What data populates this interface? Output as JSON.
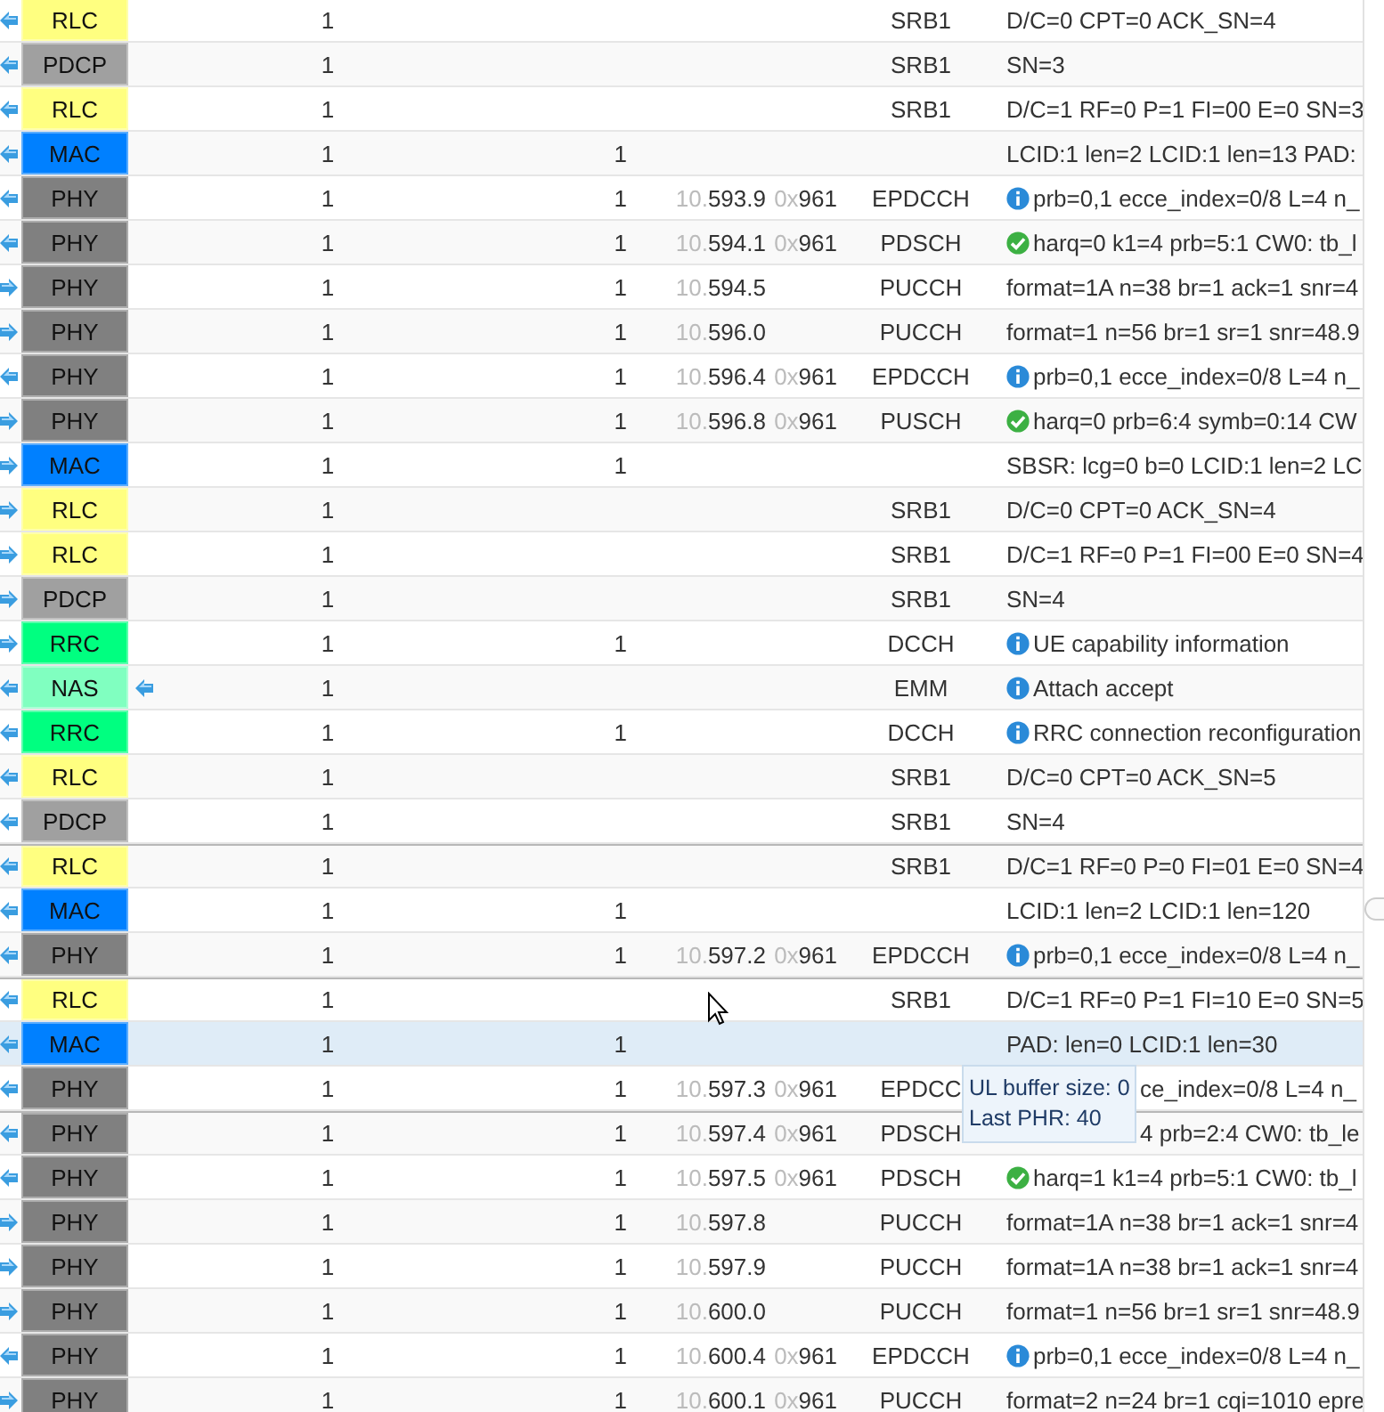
{
  "rows": [
    {
      "uplink": false,
      "layer": "RLC",
      "color": "#ffff80",
      "col2": "1",
      "channel": "SRB1",
      "kind": "plain",
      "message": "D/C=0 CPT=0 ACK_SN=4",
      "selected": false
    },
    {
      "uplink": false,
      "layer": "PDCP",
      "color": "#a0a0a0",
      "col2": "1",
      "channel": "SRB1",
      "kind": "plain",
      "message": "SN=3",
      "selected": false
    },
    {
      "uplink": false,
      "layer": "RLC",
      "color": "#ffff80",
      "col2": "1",
      "channel": "SRB1",
      "kind": "plain",
      "message": "D/C=1 RF=0 P=1 FI=00 E=0 SN=3",
      "selected": false
    },
    {
      "uplink": false,
      "layer": "MAC",
      "color": "#0080ff",
      "col2": "1",
      "col3": "1",
      "kind": "plain",
      "message": "LCID:1 len=2 LCID:1 len=13 PAD:",
      "selected": false
    },
    {
      "uplink": false,
      "layer": "PHY",
      "color": "#808080",
      "col2": "1",
      "col3": "1",
      "time_dim": "10.",
      "time": "593.9",
      "rnti_dim": "0x",
      "rnti": "961",
      "channel": "EPDCCH",
      "kind": "info",
      "message": "prb=0,1 ecce_index=0/8 L=4 n_",
      "selected": false
    },
    {
      "uplink": false,
      "layer": "PHY",
      "color": "#808080",
      "col2": "1",
      "col3": "1",
      "time_dim": "10.",
      "time": "594.1",
      "rnti_dim": "0x",
      "rnti": "961",
      "channel": "PDSCH",
      "kind": "ok",
      "message": "harq=0 k1=4 prb=5:1 CW0: tb_l",
      "selected": false
    },
    {
      "uplink": true,
      "layer": "PHY",
      "color": "#808080",
      "col2": "1",
      "col3": "1",
      "time_dim": "10.",
      "time": "594.5",
      "channel": "PUCCH",
      "kind": "plain",
      "message": "format=1A n=38 br=1 ack=1 snr=4",
      "selected": false
    },
    {
      "uplink": true,
      "layer": "PHY",
      "color": "#808080",
      "col2": "1",
      "col3": "1",
      "time_dim": "10.",
      "time": "596.0",
      "channel": "PUCCH",
      "kind": "plain",
      "message": "format=1 n=56 br=1 sr=1 snr=48.9",
      "selected": false
    },
    {
      "uplink": false,
      "layer": "PHY",
      "color": "#808080",
      "col2": "1",
      "col3": "1",
      "time_dim": "10.",
      "time": "596.4",
      "rnti_dim": "0x",
      "rnti": "961",
      "channel": "EPDCCH",
      "kind": "info",
      "message": "prb=0,1 ecce_index=0/8 L=4 n_",
      "selected": false
    },
    {
      "uplink": true,
      "layer": "PHY",
      "color": "#808080",
      "col2": "1",
      "col3": "1",
      "time_dim": "10.",
      "time": "596.8",
      "rnti_dim": "0x",
      "rnti": "961",
      "channel": "PUSCH",
      "kind": "ok",
      "message": "harq=0 prb=6:4 symb=0:14 CW",
      "selected": false
    },
    {
      "uplink": true,
      "layer": "MAC",
      "color": "#0080ff",
      "col2": "1",
      "col3": "1",
      "kind": "plain",
      "message": "SBSR: lcg=0 b=0 LCID:1 len=2 LC",
      "selected": false
    },
    {
      "uplink": true,
      "layer": "RLC",
      "color": "#ffff80",
      "col2": "1",
      "channel": "SRB1",
      "kind": "plain",
      "message": "D/C=0 CPT=0 ACK_SN=4",
      "selected": false
    },
    {
      "uplink": true,
      "layer": "RLC",
      "color": "#ffff80",
      "col2": "1",
      "channel": "SRB1",
      "kind": "plain",
      "message": "D/C=1 RF=0 P=1 FI=00 E=0 SN=4",
      "selected": false
    },
    {
      "uplink": true,
      "layer": "PDCP",
      "color": "#a0a0a0",
      "col2": "1",
      "channel": "SRB1",
      "kind": "plain",
      "message": "SN=4",
      "selected": false
    },
    {
      "uplink": true,
      "layer": "RRC",
      "color": "#00ff80",
      "col2": "1",
      "col3": "1",
      "channel": "DCCH",
      "kind": "info",
      "message": "UE capability information",
      "selected": false
    },
    {
      "uplink": false,
      "layer": "NAS",
      "color": "#80ffc0",
      "extra_arrow": true,
      "col2": "1",
      "channel": "EMM",
      "kind": "info",
      "message": "Attach accept",
      "selected": false
    },
    {
      "uplink": false,
      "layer": "RRC",
      "color": "#00ff80",
      "col2": "1",
      "col3": "1",
      "channel": "DCCH",
      "kind": "info",
      "message": "RRC connection reconfiguration",
      "selected": false
    },
    {
      "uplink": false,
      "layer": "RLC",
      "color": "#ffff80",
      "col2": "1",
      "channel": "SRB1",
      "kind": "plain",
      "message": "D/C=0 CPT=0 ACK_SN=5",
      "selected": false
    },
    {
      "uplink": false,
      "layer": "PDCP",
      "color": "#a0a0a0",
      "col2": "1",
      "channel": "SRB1",
      "kind": "plain",
      "message": "SN=4",
      "selected": false
    },
    {
      "uplink": false,
      "layer": "RLC",
      "color": "#ffff80",
      "separator": true,
      "col2": "1",
      "channel": "SRB1",
      "kind": "plain",
      "message": "D/C=1 RF=0 P=0 FI=01 E=0 SN=4",
      "selected": false
    },
    {
      "uplink": false,
      "layer": "MAC",
      "color": "#0080ff",
      "col2": "1",
      "col3": "1",
      "kind": "plain",
      "message": "LCID:1 len=2 LCID:1 len=120",
      "selected": false
    },
    {
      "uplink": false,
      "layer": "PHY",
      "color": "#808080",
      "col2": "1",
      "col3": "1",
      "time_dim": "10.",
      "time": "597.2",
      "rnti_dim": "0x",
      "rnti": "961",
      "channel": "EPDCCH",
      "kind": "info",
      "message": "prb=0,1 ecce_index=0/8 L=4 n_",
      "selected": false
    },
    {
      "uplink": false,
      "layer": "RLC",
      "color": "#ffff80",
      "separator": true,
      "col2": "1",
      "channel": "SRB1",
      "kind": "plain",
      "message": "D/C=1 RF=0 P=1 FI=10 E=0 SN=5",
      "selected": false
    },
    {
      "uplink": false,
      "layer": "MAC",
      "color": "#0080ff",
      "col2": "1",
      "col3": "1",
      "kind": "plain",
      "message": "PAD: len=0 LCID:1 len=30",
      "selected": true
    },
    {
      "uplink": false,
      "layer": "PHY",
      "color": "#808080",
      "col2": "1",
      "col3": "1",
      "time_dim": "10.",
      "time": "597.3",
      "rnti_dim": "0x",
      "rnti": "961",
      "channel": "EPDCC",
      "covered": true,
      "kind": "plain",
      "message": "ce_index=0/8 L=4 n_",
      "selected": false
    },
    {
      "uplink": false,
      "layer": "PHY",
      "color": "#808080",
      "separator": true,
      "col2": "1",
      "col3": "1",
      "time_dim": "10.",
      "time": "597.4",
      "rnti_dim": "0x",
      "rnti": "961",
      "channel": "PDSCH",
      "covered": true,
      "kind": "plain",
      "message": "4 prb=2:4 CW0: tb_le",
      "selected": false
    },
    {
      "uplink": false,
      "layer": "PHY",
      "color": "#808080",
      "col2": "1",
      "col3": "1",
      "time_dim": "10.",
      "time": "597.5",
      "rnti_dim": "0x",
      "rnti": "961",
      "channel": "PDSCH",
      "kind": "ok",
      "message": "harq=1 k1=4 prb=5:1 CW0: tb_l",
      "selected": false
    },
    {
      "uplink": true,
      "layer": "PHY",
      "color": "#808080",
      "col2": "1",
      "col3": "1",
      "time_dim": "10.",
      "time": "597.8",
      "channel": "PUCCH",
      "kind": "plain",
      "message": "format=1A n=38 br=1 ack=1 snr=4",
      "selected": false
    },
    {
      "uplink": true,
      "layer": "PHY",
      "color": "#808080",
      "col2": "1",
      "col3": "1",
      "time_dim": "10.",
      "time": "597.9",
      "channel": "PUCCH",
      "kind": "plain",
      "message": "format=1A n=38 br=1 ack=1 snr=4",
      "selected": false
    },
    {
      "uplink": true,
      "layer": "PHY",
      "color": "#808080",
      "col2": "1",
      "col3": "1",
      "time_dim": "10.",
      "time": "600.0",
      "channel": "PUCCH",
      "kind": "plain",
      "message": "format=1 n=56 br=1 sr=1 snr=48.9",
      "selected": false
    },
    {
      "uplink": false,
      "layer": "PHY",
      "color": "#808080",
      "col2": "1",
      "col3": "1",
      "time_dim": "10.",
      "time": "600.4",
      "rnti_dim": "0x",
      "rnti": "961",
      "channel": "EPDCCH",
      "kind": "info",
      "message": "prb=0,1 ecce_index=0/8 L=4 n_",
      "selected": false
    },
    {
      "uplink": true,
      "layer": "PHY",
      "color": "#808080",
      "col2": "1",
      "col3": "1",
      "time_dim": "10.",
      "time": "600.1",
      "rnti_dim": "0x",
      "rnti": "961",
      "channel": "PUCCH",
      "kind": "plain",
      "message": "format=2 n=24 br=1 cqi=1010 epre",
      "selected": false
    }
  ],
  "tooltip": {
    "lines": [
      "UL buffer size: 0",
      "Last PHR: 40"
    ]
  }
}
